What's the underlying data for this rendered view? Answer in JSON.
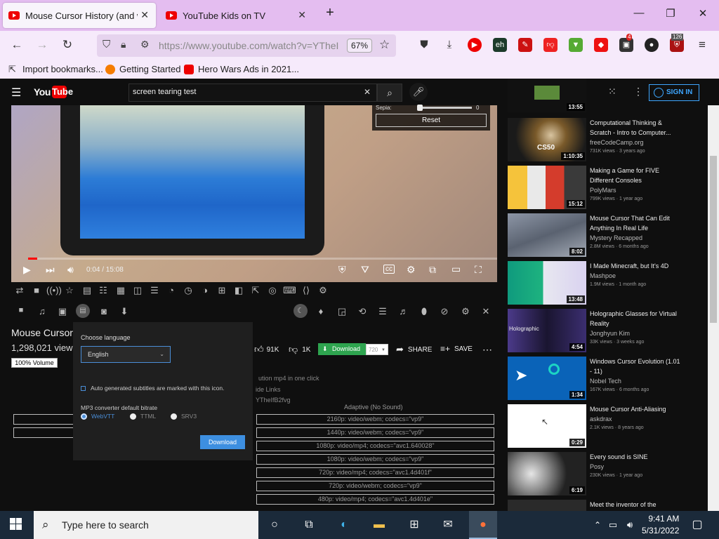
{
  "browser": {
    "tabs": [
      {
        "title": "Mouse Cursor History (and why"
      },
      {
        "title": "YouTube Kids on TV"
      }
    ],
    "url": "https://www.youtube.com/watch?v=YTheI",
    "zoom": "67%",
    "bookmarks": [
      "Import bookmarks...",
      "Getting Started",
      "Hero Wars Ads in 2021..."
    ],
    "ext_badges": {
      "badge1": "4",
      "badge2": "126"
    }
  },
  "youtube": {
    "search_query": "screen tearing test",
    "sign_in": "SIGN IN",
    "player": {
      "time": "0:04 / 15:08",
      "sepia_label": "Sepia:",
      "sepia_value": "0",
      "reset": "Reset",
      "progress": 0.004
    },
    "video": {
      "title": "Mouse Cursor",
      "views": "1,298,021 views",
      "volume_badge": "100% Volume",
      "likes": "91K",
      "dislikes": "1K",
      "download": "Download",
      "quality": "720",
      "share": "SHARE",
      "save": "SAVE"
    },
    "info_lines": [
      "ution mp4 in one click",
      "ide Links",
      "YTheIfB2fvg"
    ],
    "adaptive_title": "Adaptive (No Sound)",
    "formats": [
      "2160p: video/webm; codecs=\"vp9\"",
      "1440p: video/webm; codecs=\"vp9\"",
      "1080p: video/mp4; codecs=\"avc1.640028\"",
      "1080p: video/webm; codecs=\"vp9\"",
      "720p: video/mp4; codecs=\"avc1.4d401f\"",
      "720p: video/webm; codecs=\"vp9\"",
      "480p: video/mp4; codecs=\"avc1.4d401e\""
    ],
    "language_popup": {
      "choose_language": "Choose language",
      "selected_language": "English",
      "note": "Auto generated subtitles are marked with this icon.",
      "bitrate_label": "MP3 converter default bitrate",
      "options": [
        "WebVTT",
        "TTML",
        "SRV3"
      ],
      "download": "Download"
    },
    "recommendations": [
      {
        "title_l1": "",
        "title_l2": "",
        "channel": "",
        "meta": "",
        "duration": "13:55"
      },
      {
        "title_l1": "Computational Thinking &",
        "title_l2": "Scratch - Intro to Computer...",
        "channel": "freeCodeCamp.org",
        "meta": "731K views · 3 years ago",
        "duration": "1:10:35",
        "thumb_text": "CS50"
      },
      {
        "title_l1": "Making a Game for FIVE",
        "title_l2": "Different Consoles",
        "channel": "PolyMars",
        "meta": "799K views · 1 year ago",
        "duration": "15:12"
      },
      {
        "title_l1": "Mouse Cursor That Can Edit",
        "title_l2": "Anything In Real Life",
        "channel": "Mystery Recapped",
        "meta": "2.8M views · 6 months ago",
        "duration": "8:02"
      },
      {
        "title_l1": "I Made Minecraft, but It's 4D",
        "title_l2": "",
        "channel": "Mashpoe",
        "meta": "1.9M views · 1 month ago",
        "duration": "13:48"
      },
      {
        "title_l1": "Holographic Glasses for Virtual",
        "title_l2": "Reality",
        "channel": "Jonghyun Kim",
        "meta": "33K views · 3 weeks ago",
        "duration": "4:54",
        "thumb_text": "Holographic"
      },
      {
        "title_l1": "Windows Cursor Evolution (1.01",
        "title_l2": "- 11)",
        "channel": "Nobel Tech",
        "meta": "167K views · 6 months ago",
        "duration": "1:34"
      },
      {
        "title_l1": "Mouse Cursor Anti-Aliasing",
        "title_l2": "",
        "channel": "askdrax",
        "meta": "2.1K views · 8 years ago",
        "duration": "0:29"
      },
      {
        "title_l1": "Every sound is SINE",
        "title_l2": "",
        "channel": "Posy",
        "meta": "230K views · 1 year ago",
        "duration": "6:19"
      },
      {
        "title_l1": "Meet the inventor of the",
        "title_l2": "",
        "channel": "",
        "meta": "",
        "duration": ""
      }
    ]
  },
  "taskbar": {
    "search_placeholder": "Type here to search",
    "time": "9:41 AM",
    "date": "5/31/2022"
  }
}
